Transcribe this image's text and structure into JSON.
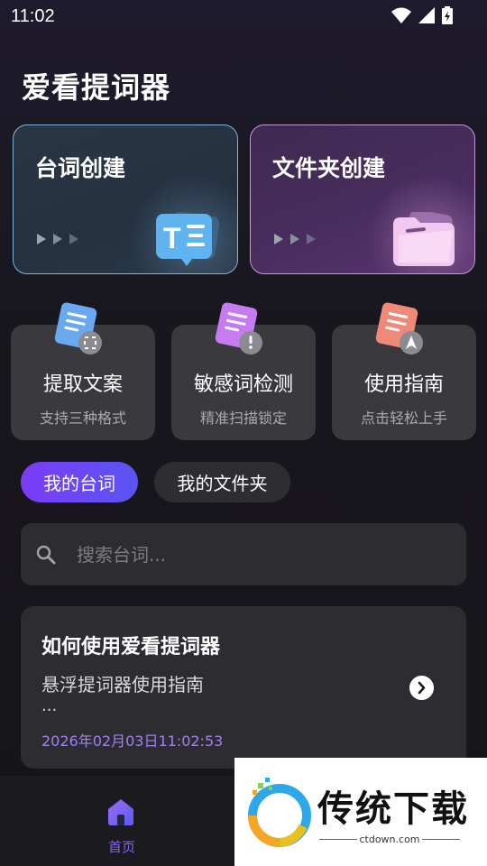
{
  "status": {
    "time": "11:02"
  },
  "app_title": "爱看提词器",
  "big_cards": [
    {
      "title": "台词创建"
    },
    {
      "title": "文件夹创建"
    }
  ],
  "features": [
    {
      "title": "提取文案",
      "subtitle": "支持三种格式"
    },
    {
      "title": "敏感词检测",
      "subtitle": "精准扫描锁定"
    },
    {
      "title": "使用指南",
      "subtitle": "点击轻松上手"
    }
  ],
  "tabs": [
    {
      "label": "我的台词",
      "active": true
    },
    {
      "label": "我的文件夹",
      "active": false
    }
  ],
  "search": {
    "placeholder": "搜索台词..."
  },
  "items": [
    {
      "title": "如何使用爱看提词器",
      "subtitle": "悬浮提词器使用指南",
      "ellipsis": "...",
      "date": "2026年02月03日11:02:53"
    }
  ],
  "bottom_nav": {
    "home_label": "首页"
  },
  "watermark": {
    "brand": "传统下载",
    "url": "ctdown.com"
  },
  "colors": {
    "accent": "#7b3cf6",
    "date": "#a57ef2"
  },
  "icons": [
    "wifi-icon",
    "signal-icon",
    "battery-icon",
    "text-doc-icon",
    "folder-icon",
    "extract-doc-icon",
    "warning-doc-icon",
    "guide-doc-icon",
    "search-icon",
    "chevron-right-icon",
    "home-icon"
  ]
}
